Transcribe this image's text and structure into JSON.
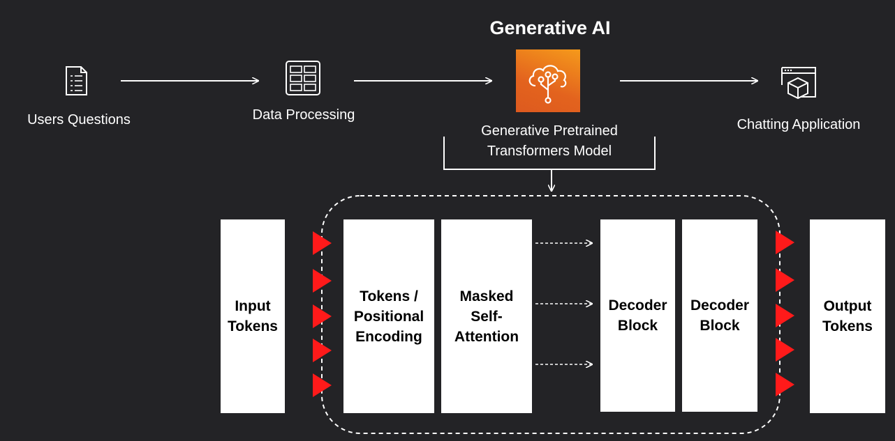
{
  "title": "Generative AI",
  "pipeline": {
    "users_questions": "Users Questions",
    "data_processing": "Data Processing",
    "gpt_model": "Generative Pretrained\nTransformers Model",
    "chatting_application": "Chatting Application"
  },
  "blocks": {
    "input_tokens": "Input\nTokens",
    "positional_encoding": "Tokens /\nPositional\nEncoding",
    "masked_self_attention": "Masked\nSelf-\nAttention",
    "decoder_block_1": "Decoder\nBlock",
    "decoder_block_2": "Decoder\nBlock",
    "output_tokens": "Output\nTokens"
  },
  "colors": {
    "background": "#232326",
    "box": "#ffffff",
    "triangle": "#ff1a1a",
    "gen_ai_tile": "#ef7d1b"
  },
  "icons": {
    "users_questions": "document-list-icon",
    "data_processing": "server-rack-icon",
    "generative_ai": "cloud-tree-icon",
    "chatting_application": "browser-cube-icon"
  }
}
